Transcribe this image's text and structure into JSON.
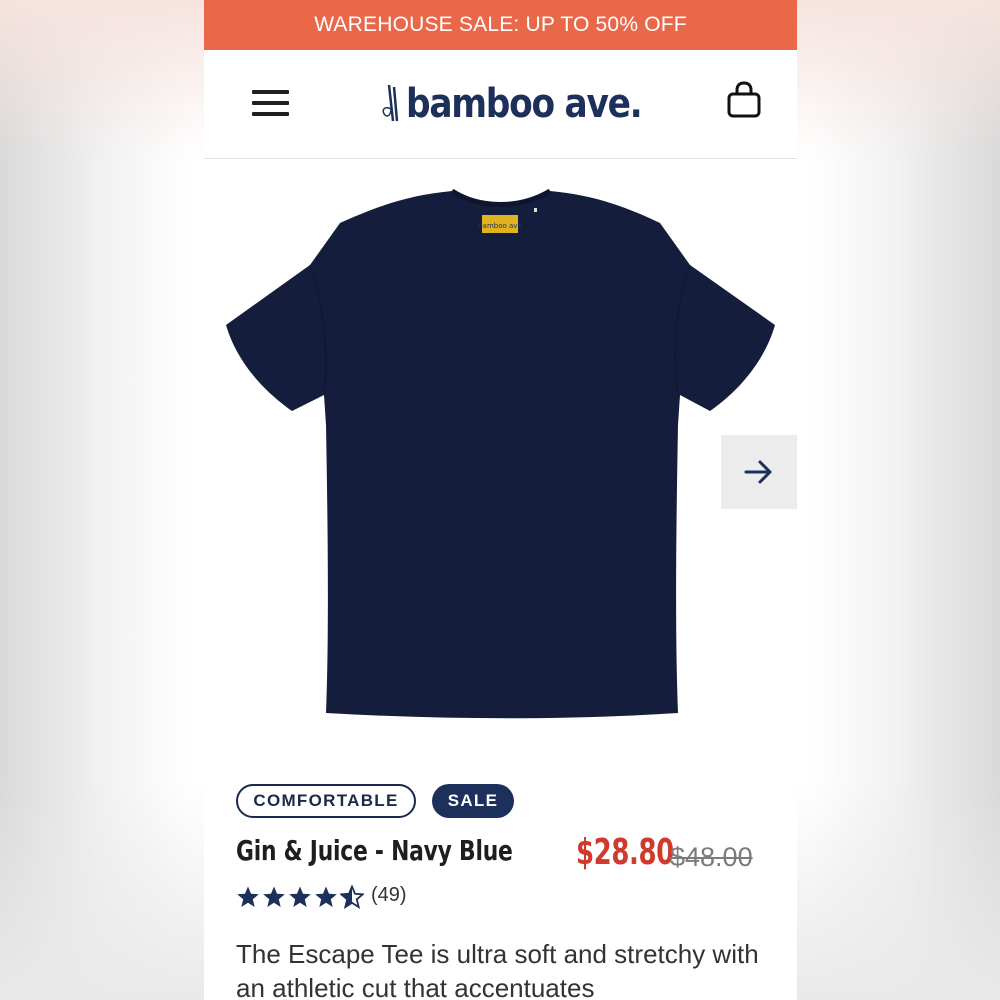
{
  "promo_banner": {
    "text": "WAREHOUSE SALE: UP TO 50% OFF",
    "bg_color": "#e9684a"
  },
  "header": {
    "menu_icon": "hamburger-menu-icon",
    "logo_text": "bamboo ave.",
    "cart_icon": "shopping-bag-icon",
    "brand_color": "#1d2f5b"
  },
  "gallery": {
    "image": "navy-tshirt",
    "label_tag_text": "bamboo ave",
    "next_icon": "arrow-right-icon"
  },
  "product": {
    "badges": [
      "COMFORTABLE",
      "SALE"
    ],
    "title": "Gin & Juice - Navy Blue",
    "sale_price": "$28.80",
    "original_price": "$48.00",
    "sale_price_color": "#cf3a2c",
    "rating": 4.5,
    "rating_max": 5,
    "review_count": "(49)",
    "description": "The Escape Tee is ultra soft and stretchy with an athletic cut that accentuates"
  }
}
